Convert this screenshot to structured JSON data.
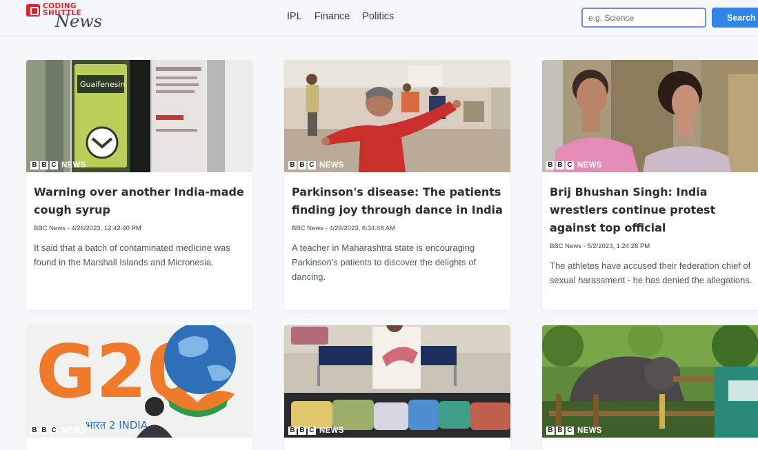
{
  "brand": {
    "line1": "CODING",
    "line2": "SHUTTLE",
    "script": "News"
  },
  "nav": {
    "links": [
      "IPL",
      "Finance",
      "Politics"
    ]
  },
  "search": {
    "placeholder": "e.g. Science",
    "button_label": "Search",
    "accent": "#2f86e8"
  },
  "source_badge": {
    "letters": [
      "B",
      "B",
      "C"
    ],
    "news": "NEWS"
  },
  "articles": [
    {
      "title": "Warning over another India-made cough syrup",
      "meta": "BBC News - 4/26/2023, 12:42:40 PM",
      "description": "It said that a batch of contaminated medicine was found in the Marshall Islands and Micronesia.",
      "image_label": "Guaifenesin"
    },
    {
      "title": "Parkinson's disease: The patients finding joy through dance in India",
      "meta": "BBC News - 4/29/2023, 6:34:48 AM",
      "description": "A teacher in Maharashtra state is encouraging Parkinson's patients to discover the delights of dancing."
    },
    {
      "title": "Brij Bhushan Singh: India wrestlers continue protest against top official",
      "meta": "BBC News - 5/2/2023, 1:24:26 PM",
      "description": "The athletes have accused their federation chief of sexual harassment - he has denied the allegations."
    },
    {
      "image_label": "G20",
      "image_sublabel": "भारत 2 INDIA"
    },
    {},
    {}
  ]
}
